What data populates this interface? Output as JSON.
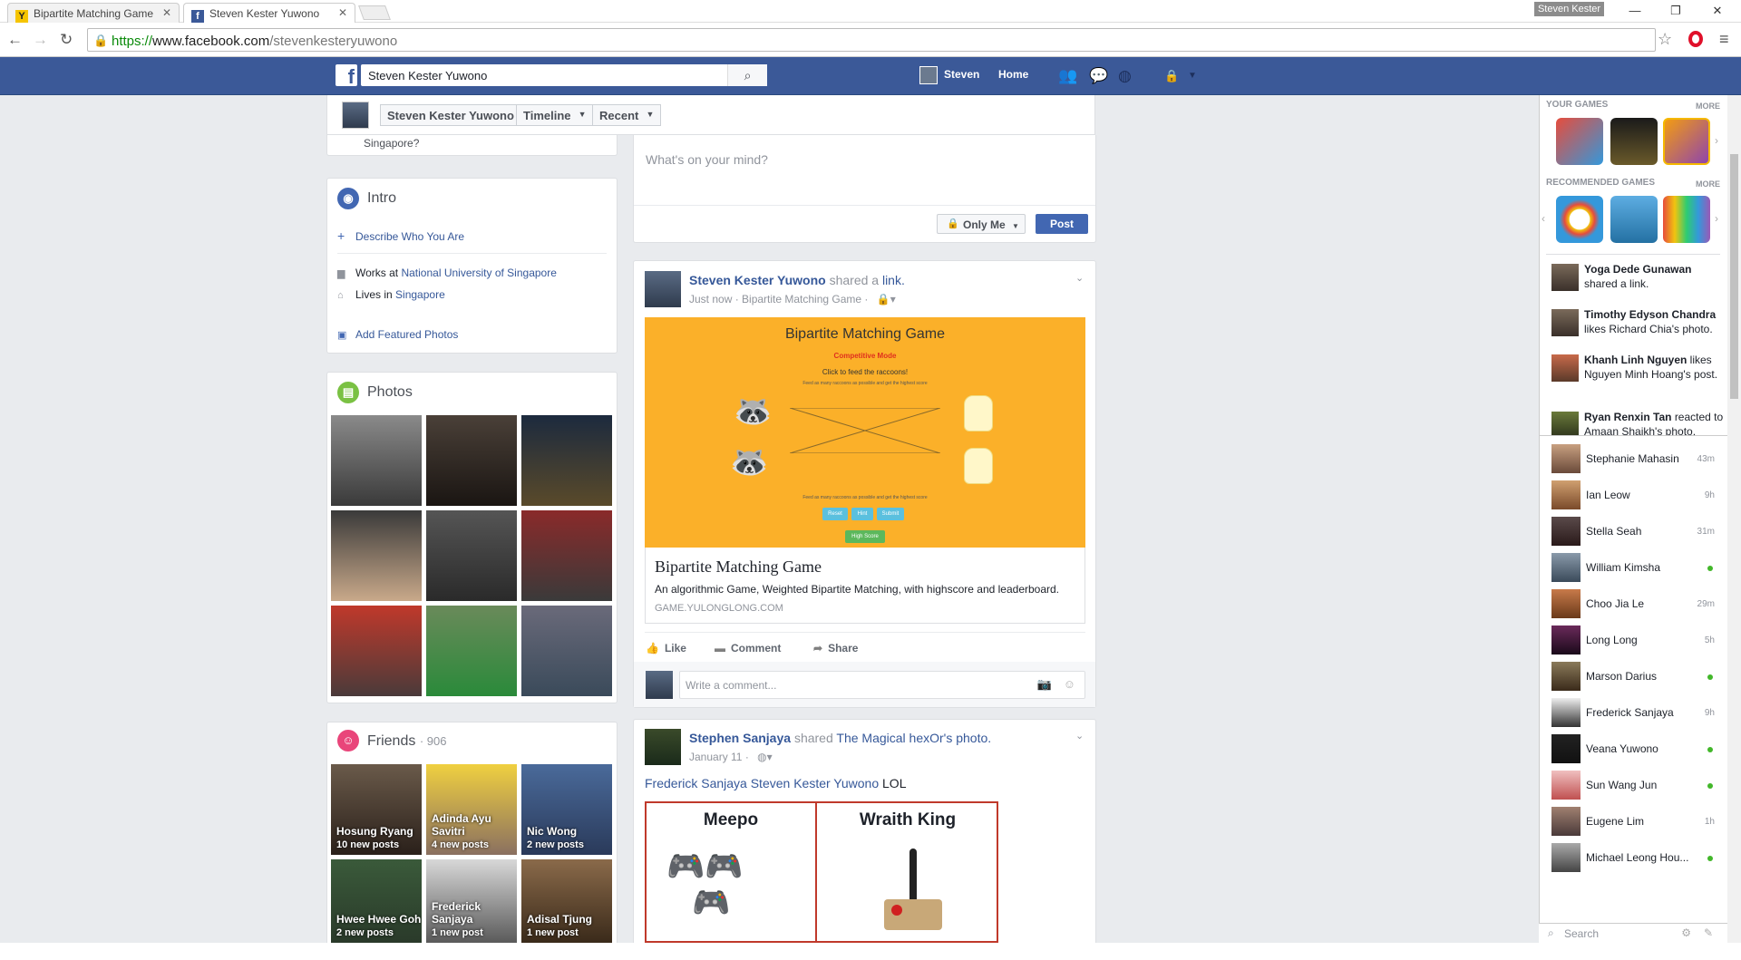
{
  "browser": {
    "tabs": [
      {
        "title": "Bipartite Matching Game",
        "favicon": "Y"
      },
      {
        "title": "Steven Kester Yuwono",
        "favicon": "f"
      }
    ],
    "profile_chip": "Steven Kester",
    "url_protocol": "https://",
    "url_host": "www.facebook.com",
    "url_path": "/stevenkesteryuwono"
  },
  "fb_header": {
    "search_value": "Steven Kester Yuwono",
    "user_name": "Steven",
    "home_label": "Home"
  },
  "subheader": {
    "name": "Steven Kester Yuwono",
    "timeline_label": "Timeline",
    "recent_label": "Recent"
  },
  "intro": {
    "partial_text": "Singapore?",
    "title": "Intro",
    "describe_label": "Describe Who You Are",
    "works_prefix": "Works at",
    "works_link": "National University of Singapore",
    "lives_prefix": "Lives in",
    "lives_link": "Singapore",
    "featured_label": "Add Featured Photos"
  },
  "photos": {
    "title": "Photos"
  },
  "friends": {
    "title": "Friends",
    "count": "· 906",
    "items": [
      {
        "name": "Hosung Ryang",
        "sub": "10 new posts"
      },
      {
        "name": "Adinda Ayu Savitri",
        "sub": "4 new posts"
      },
      {
        "name": "Nic Wong",
        "sub": "2 new posts"
      },
      {
        "name": "Hwee Hwee Goh",
        "sub": "2 new posts"
      },
      {
        "name": "Frederick Sanjaya",
        "sub": "1 new post"
      },
      {
        "name": "Adisal Tjung",
        "sub": "1 new post"
      }
    ]
  },
  "composer": {
    "placeholder": "What's on your mind?",
    "privacy_label": "Only Me",
    "post_label": "Post"
  },
  "post1": {
    "author": "Steven Kester Yuwono",
    "action": "shared a",
    "action_link": "link.",
    "meta": "Just now · Bipartite Matching Game ·",
    "preview": {
      "title": "Bipartite Matching Game",
      "mode": "Competitive Mode",
      "instruction": "Click to feed the raccoons!",
      "small_top": "Feed as many raccoons as possible and get the highest score",
      "small_bottom": "Feed as many raccoons as possible and get the highest score",
      "btn_reset": "Reset",
      "btn_hint": "Hint",
      "btn_submit": "Submit",
      "btn_high": "High Score"
    },
    "link_title": "Bipartite Matching Game",
    "link_desc": "An algorithmic Game, Weighted Bipartite Matching, with highscore and leaderboard.",
    "link_domain": "GAME.YULONGLONG.COM",
    "like_label": "Like",
    "comment_label": "Comment",
    "share_label": "Share",
    "comment_placeholder": "Write a comment..."
  },
  "post2": {
    "author": "Stephen Sanjaya",
    "action": "shared",
    "action_link": "The Magical hexOr's photo.",
    "meta": "January 11 ·",
    "tag1": "Frederick Sanjaya",
    "tag2": "Steven Kester Yuwono",
    "text": "LOL",
    "meme_left": "Meepo",
    "meme_right": "Wraith King"
  },
  "sidebar": {
    "your_games": "YOUR GAMES",
    "more1": "MORE",
    "recommended_games": "RECOMMENDED GAMES",
    "more2": "MORE",
    "ticker": [
      {
        "name": "Yoga Dede Gunawan",
        "text": "shared a link."
      },
      {
        "name": "Timothy Edyson Chandra",
        "text": "likes Richard Chia's photo."
      },
      {
        "name": "Khanh Linh Nguyen",
        "text": "likes Nguyen Minh Hoang's post."
      },
      {
        "name": "Ryan Renxin Tan",
        "text": "reacted to Amaan Shaikh's photo."
      }
    ],
    "chat": [
      {
        "name": "Stephanie Mahasin",
        "time": "43m"
      },
      {
        "name": "Ian Leow",
        "time": "9h"
      },
      {
        "name": "Stella Seah",
        "time": "31m"
      },
      {
        "name": "William Kimsha",
        "time": ""
      },
      {
        "name": "Choo Jia Le",
        "time": "29m"
      },
      {
        "name": "Long Long",
        "time": "5h"
      },
      {
        "name": "Marson Darius",
        "time": ""
      },
      {
        "name": "Frederick Sanjaya",
        "time": "9h"
      },
      {
        "name": "Veana Yuwono",
        "time": ""
      },
      {
        "name": "Sun Wang Jun",
        "time": ""
      },
      {
        "name": "Eugene Lim",
        "time": "1h"
      },
      {
        "name": "Michael Leong Hou...",
        "time": ""
      }
    ],
    "search_placeholder": "Search"
  },
  "colors": {
    "fb_blue": "#3b5998",
    "link": "#365899",
    "online": "#42b72a",
    "game_bg": "#fbb029"
  }
}
